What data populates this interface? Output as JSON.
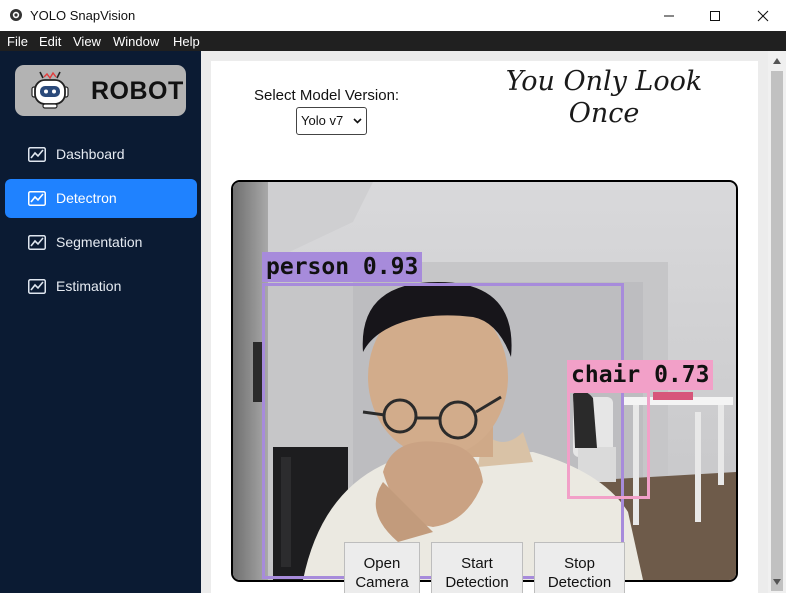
{
  "window": {
    "title": "YOLO SnapVision"
  },
  "menu": [
    "File",
    "Edit",
    "View",
    "Window",
    "Help"
  ],
  "sidebar": {
    "logo_text": "ROBOT",
    "items": [
      {
        "label": "Dashboard",
        "icon": "chart-icon",
        "active": false
      },
      {
        "label": "Detectron",
        "icon": "chart-icon",
        "active": true
      },
      {
        "label": "Segmentation",
        "icon": "chart-icon",
        "active": false
      },
      {
        "label": "Estimation",
        "icon": "chart-icon",
        "active": false
      }
    ]
  },
  "main": {
    "model_label": "Select Model Version:",
    "model_selected": "Yolo v7",
    "slogan_line1": "You Only Look",
    "slogan_line2": "Once",
    "detections": [
      {
        "label": "person 0.93",
        "color": "#a78bdb"
      },
      {
        "label": "chair 0.73",
        "color": "#f2a0c8"
      }
    ],
    "buttons": [
      {
        "line1": "Open",
        "line2": "Camera"
      },
      {
        "line1": "Start",
        "line2": "Detection"
      },
      {
        "line1": "Stop",
        "line2": "Detection"
      }
    ]
  },
  "colors": {
    "sidebar_bg": "#0b1b33",
    "active_item": "#1f82ff",
    "menubar_bg": "#202020"
  }
}
